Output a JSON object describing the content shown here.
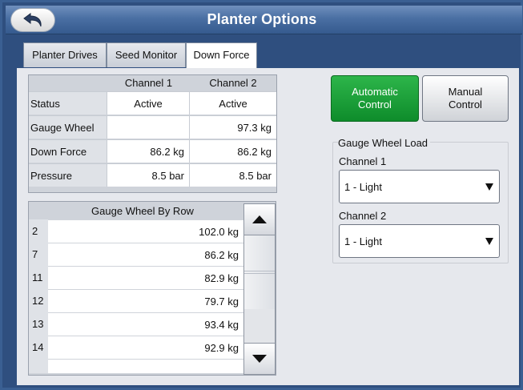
{
  "window": {
    "title": "Planter Options"
  },
  "tabs": [
    {
      "label": "Planter Drives",
      "active": false
    },
    {
      "label": "Seed Monitor",
      "active": false
    },
    {
      "label": "Down Force",
      "active": true
    }
  ],
  "status_table": {
    "columns": [
      "Channel 1",
      "Channel 2"
    ],
    "rows": [
      {
        "label": "Status",
        "ch1": "Active",
        "ch2": "Active"
      },
      {
        "label": "Gauge Wheel",
        "ch1": "",
        "ch2": "97.3 kg"
      },
      {
        "label": "Down Force",
        "ch1": "86.2 kg",
        "ch2": "86.2 kg"
      },
      {
        "label": "Pressure",
        "ch1": "8.5 bar",
        "ch2": "8.5 bar"
      }
    ]
  },
  "row_table": {
    "title": "Gauge Wheel By Row",
    "rows": [
      {
        "row": "2",
        "value": "102.0 kg"
      },
      {
        "row": "7",
        "value": "86.2 kg"
      },
      {
        "row": "11",
        "value": "82.9 kg"
      },
      {
        "row": "12",
        "value": "79.7 kg"
      },
      {
        "row": "13",
        "value": "93.4 kg"
      },
      {
        "row": "14",
        "value": "92.9 kg"
      }
    ]
  },
  "controls": {
    "automatic": "Automatic\nControl",
    "manual": "Manual\nControl",
    "active": "automatic",
    "active_color": "#1aa23a"
  },
  "gauge_wheel_load": {
    "title": "Gauge Wheel Load",
    "channel1_label": "Channel 1",
    "channel1_value": "1 - Light",
    "channel2_label": "Channel 2",
    "channel2_value": "1 - Light"
  }
}
